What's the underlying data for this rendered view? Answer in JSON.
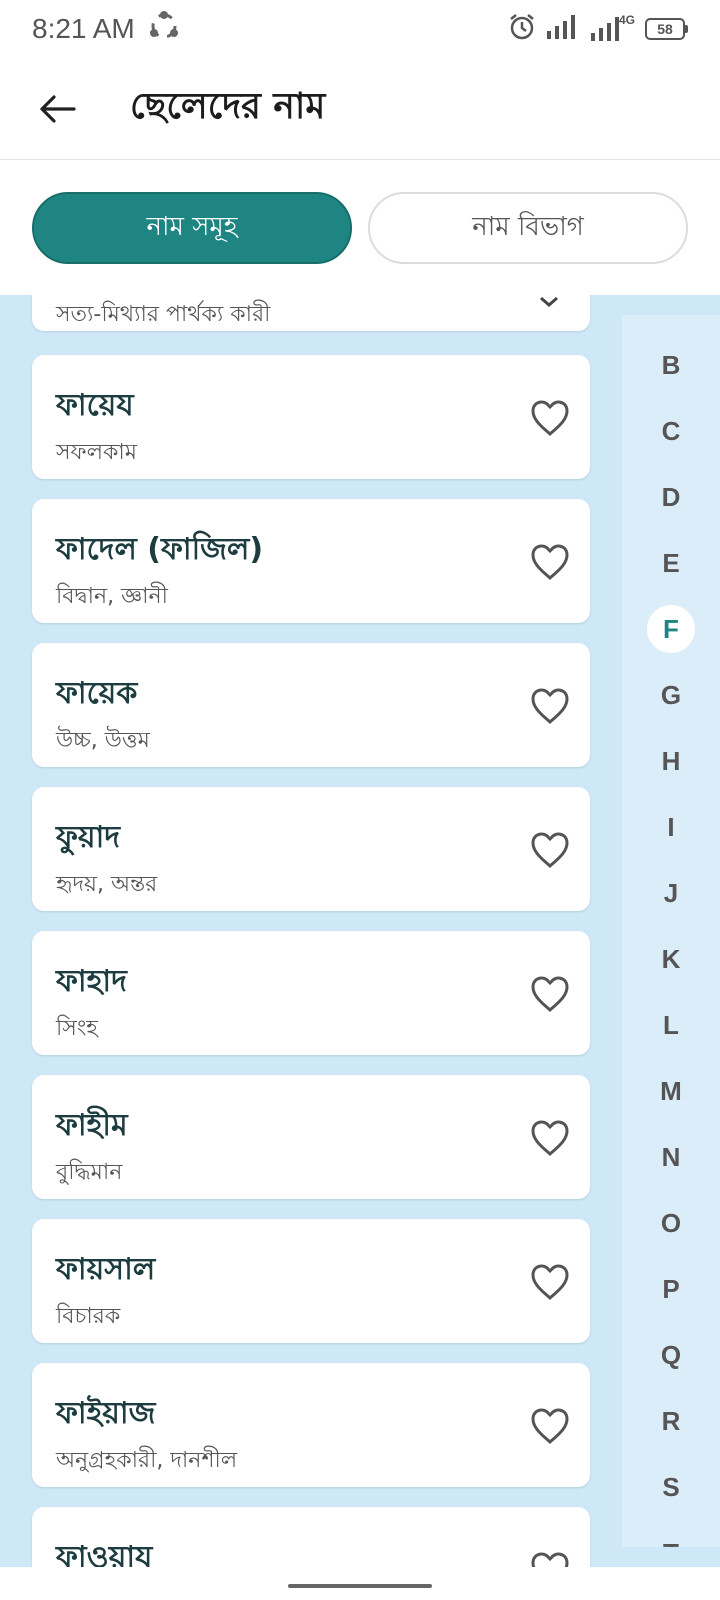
{
  "status": {
    "time": "8:21 AM",
    "network": "4G",
    "battery": "58"
  },
  "header": {
    "title": "ছেলেদের নাম"
  },
  "tabs": [
    {
      "label": "নাম সমূহ",
      "active": true
    },
    {
      "label": "নাম বিভাগ",
      "active": false
    }
  ],
  "partial_top_meaning": "সত্য-মিথ্যার পার্থক্য কারী",
  "names": [
    {
      "name": "ফায়েয",
      "meaning": "সফলকাম"
    },
    {
      "name": "ফাদেল (ফাজিল)",
      "meaning": "বিদ্বান, জ্ঞানী"
    },
    {
      "name": "ফায়েক",
      "meaning": "উচ্চ, উত্তম"
    },
    {
      "name": "ফুয়াদ",
      "meaning": "হৃদয়, অন্তর"
    },
    {
      "name": "ফাহাদ",
      "meaning": " সিংহ"
    },
    {
      "name": "ফাহীম",
      "meaning": "বুদ্ধিমান"
    },
    {
      "name": "ফায়সাল",
      "meaning": " বিচারক"
    },
    {
      "name": "ফাইয়াজ",
      "meaning": "অনুগ্রহকারী, দানশীল"
    },
    {
      "name": "ফাওয়ায",
      "meaning": ""
    }
  ],
  "alphabet": [
    "B",
    "C",
    "D",
    "E",
    "F",
    "G",
    "H",
    "I",
    "J",
    "K",
    "L",
    "M",
    "N",
    "O",
    "P",
    "Q",
    "R",
    "S",
    "T"
  ],
  "alphabet_selected": "F",
  "colors": {
    "accent": "#1f8582",
    "list_bg": "#cfe8f8",
    "index_bg": "#dcedfa"
  }
}
